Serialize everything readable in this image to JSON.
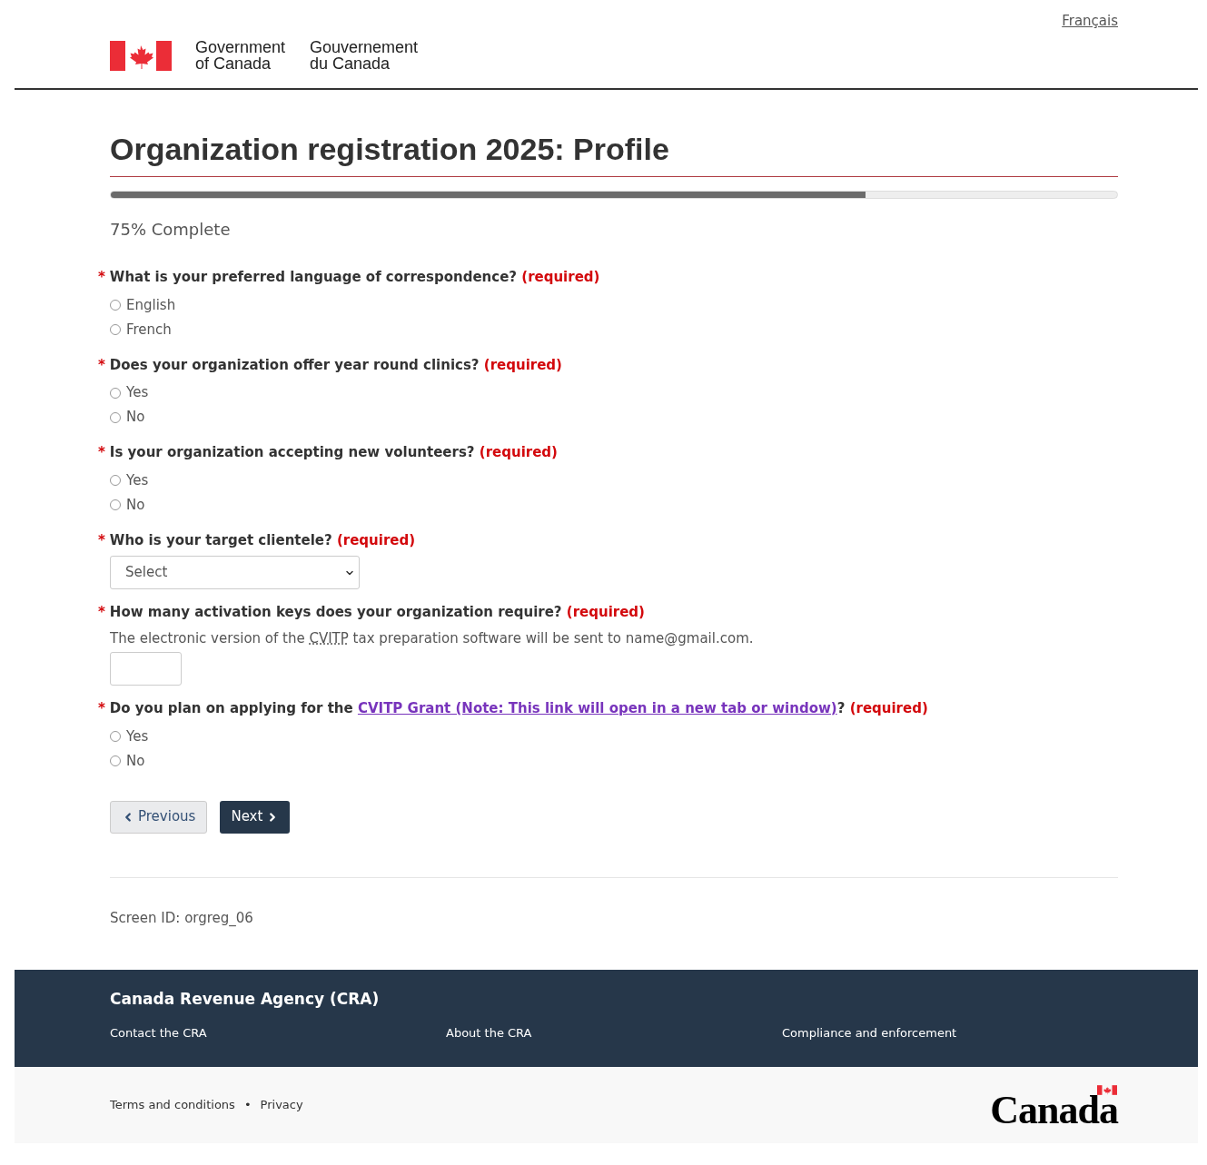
{
  "language_link": "Français",
  "signature": {
    "en_line1": "Government",
    "en_line2": "of Canada",
    "fr_line1": "Gouvernement",
    "fr_line2": "du Canada"
  },
  "title": "Organization registration 2025: Profile",
  "progress": {
    "level": 0.75,
    "label": "75% Complete"
  },
  "questions": [
    {
      "kind": "radio",
      "asterisk": "*",
      "label": "What is your preferred language of correspondence?",
      "required": "(required)",
      "options": [
        {
          "label": "English",
          "selected": false
        },
        {
          "label": "French",
          "selected": false
        }
      ]
    },
    {
      "kind": "radio",
      "asterisk": "*",
      "label": "Does your organization offer year round clinics?",
      "required": "(required)",
      "options": [
        {
          "label": "Yes",
          "selected": false
        },
        {
          "label": "No",
          "selected": false
        }
      ]
    },
    {
      "kind": "radio",
      "asterisk": "*",
      "label": "Is your organization accepting new volunteers?",
      "required": "(required)",
      "options": [
        {
          "label": "Yes",
          "selected": false
        },
        {
          "label": "No",
          "selected": false
        }
      ]
    },
    {
      "kind": "select",
      "asterisk": "*",
      "label": "Who is your target clientele?",
      "required": "(required)",
      "value": "Select"
    },
    {
      "kind": "number",
      "asterisk": "*",
      "label": "How many activation keys does your organization require?",
      "required": "(required)",
      "description": {
        "before": "The electronic version of the ",
        "abbr": "CVITP",
        "after": " tax preparation software will be sent to name@gmail.com."
      }
    },
    {
      "kind": "radio",
      "asterisk": "*",
      "label": "Do you plan on applying for the",
      "link": "CVITP Grant (Note: This link will open in a new tab or window)",
      "label_after": "?",
      "required": "(required)",
      "options": [
        {
          "label": "Yes",
          "selected": false
        },
        {
          "label": "No",
          "selected": false
        }
      ]
    }
  ],
  "buttons": {
    "previous": "Previous",
    "next": "Next"
  },
  "screen_id": "Screen ID: orgreg_06",
  "footer": {
    "title": "Canada Revenue Agency (CRA)",
    "links": [
      "Contact the CRA",
      "About the CRA",
      "Compliance and enforcement"
    ],
    "sub_links": [
      "Terms and conditions",
      "Privacy"
    ],
    "separator": "•",
    "wordmark": "Canada"
  }
}
